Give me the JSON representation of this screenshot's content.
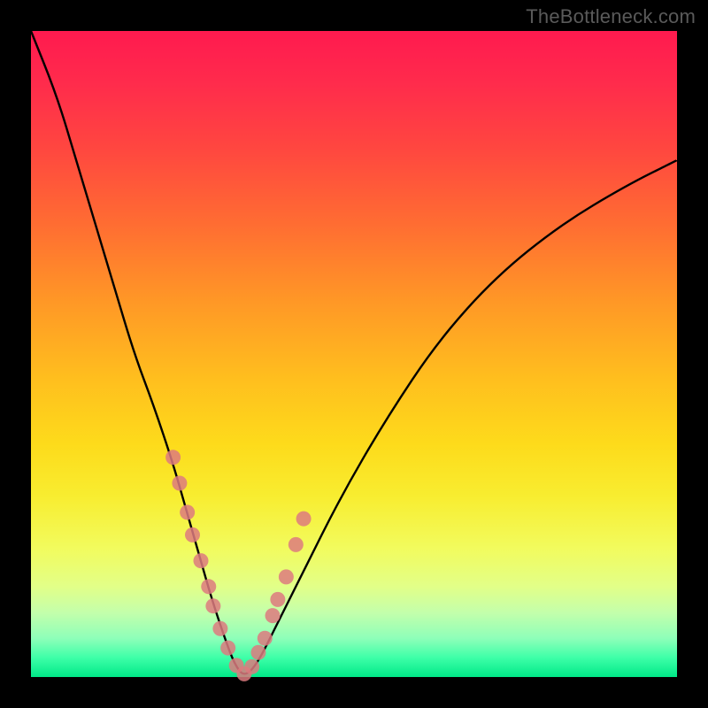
{
  "watermark": "TheBottleneck.com",
  "chart_data": {
    "type": "line",
    "title": "",
    "xlabel": "",
    "ylabel": "",
    "xlim": [
      0,
      100
    ],
    "ylim": [
      0,
      100
    ],
    "note": "Axes unlabeled; values estimated from geometry. x≈configuration index, y≈bottleneck severity (0=green/optimal at bottom, 100=red/severe at top).",
    "series": [
      {
        "name": "bottleneck-curve",
        "x": [
          0,
          4,
          7,
          10,
          13,
          16,
          19,
          22,
          24,
          26,
          28,
          30,
          31.5,
          33,
          35,
          38,
          42,
          48,
          55,
          63,
          72,
          82,
          92,
          100
        ],
        "y": [
          100,
          90,
          80,
          70,
          60,
          50,
          42,
          33,
          26,
          19,
          12,
          6,
          2,
          0,
          2,
          8,
          16,
          28,
          40,
          52,
          62,
          70,
          76,
          80
        ]
      }
    ],
    "highlight_points": {
      "name": "marked-configurations",
      "x": [
        22,
        23,
        24.2,
        25,
        26.3,
        27.5,
        28.2,
        29.3,
        30.5,
        31.8,
        33.0,
        34.2,
        35.2,
        36.2,
        37.4,
        38.2,
        39.5,
        41.0,
        42.2
      ],
      "y": [
        34,
        30,
        25.5,
        22,
        18,
        14,
        11,
        7.5,
        4.5,
        1.8,
        0.5,
        1.6,
        3.8,
        6.0,
        9.5,
        12.0,
        15.5,
        20.5,
        24.5
      ]
    },
    "background_gradient": {
      "orientation": "vertical",
      "stops": [
        {
          "pos": 0.0,
          "color": "#ff1a4f"
        },
        {
          "pos": 0.3,
          "color": "#ff6d32"
        },
        {
          "pos": 0.55,
          "color": "#ffbf1e"
        },
        {
          "pos": 0.75,
          "color": "#f6f93f"
        },
        {
          "pos": 0.9,
          "color": "#c4ffab"
        },
        {
          "pos": 1.0,
          "color": "#00e988"
        }
      ]
    }
  }
}
